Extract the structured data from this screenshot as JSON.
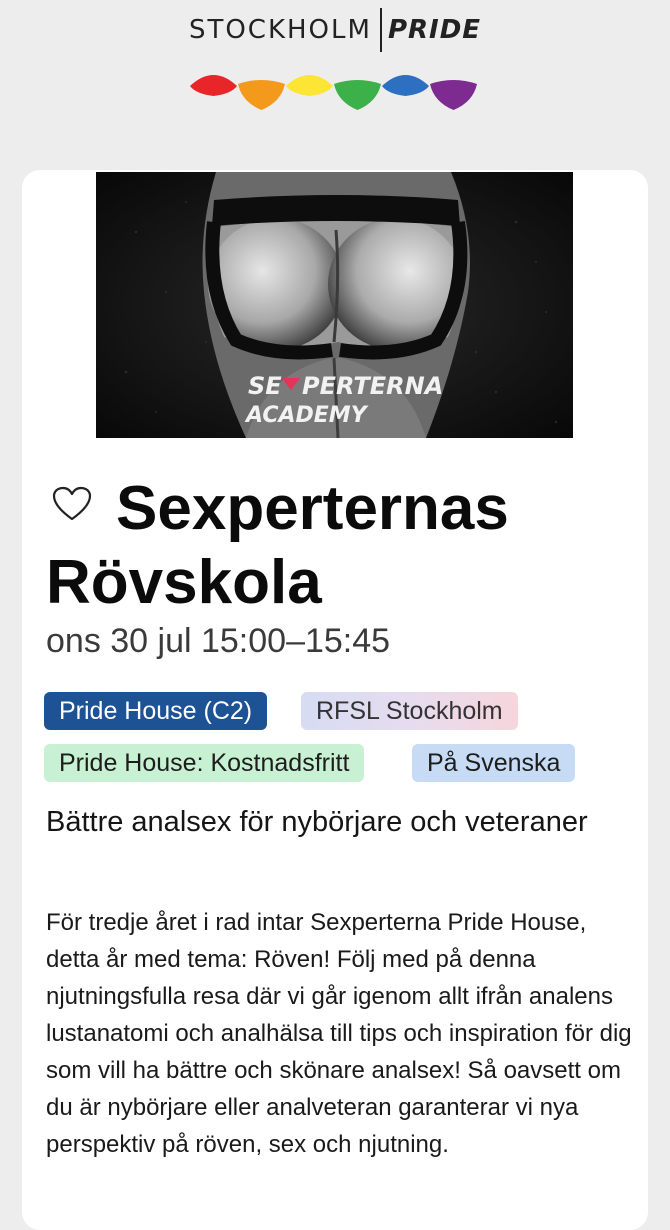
{
  "brand": {
    "city": "STOCKHOLM",
    "pride": "PRIDE",
    "rainbow_colors": [
      "#e8262a",
      "#f39a1c",
      "#fde535",
      "#3cb049",
      "#2d6fc0",
      "#7d2a91"
    ]
  },
  "event": {
    "image_text_line1": "SE",
    "image_text_line1b": "PERTERNA",
    "image_text_line2": "ACADEMY",
    "favorite_icon": "heart-outline-icon",
    "title": "Sexperternas Rövskola",
    "datetime": "ons 30 jul 15:00–15:45",
    "tags": {
      "venue": "Pride House (C2)",
      "organizer": "RFSL Stockholm",
      "price": "Pride House: Kostnadsfritt",
      "language": "På Svenska"
    },
    "subtitle": "Bättre analsex för nybörjare och veteraner",
    "description": "För tredje året i rad intar Sexperterna Pride House, detta år med tema: Röven! Följ med på denna njutningsfulla resa där vi går igenom allt ifrån analens lustanatomi och analhälsa till tips och inspiration för dig som vill ha bättre och skönare analsex! Så oavsett om du är nybörjare eller analveteran garanterar vi nya perspektiv på röven, sex och njutning."
  },
  "colors": {
    "venue_tag": "#1d5295",
    "price_tag": "#c8f0d2",
    "language_tag": "#c7dbf5",
    "image_heart": "#e8325a"
  }
}
